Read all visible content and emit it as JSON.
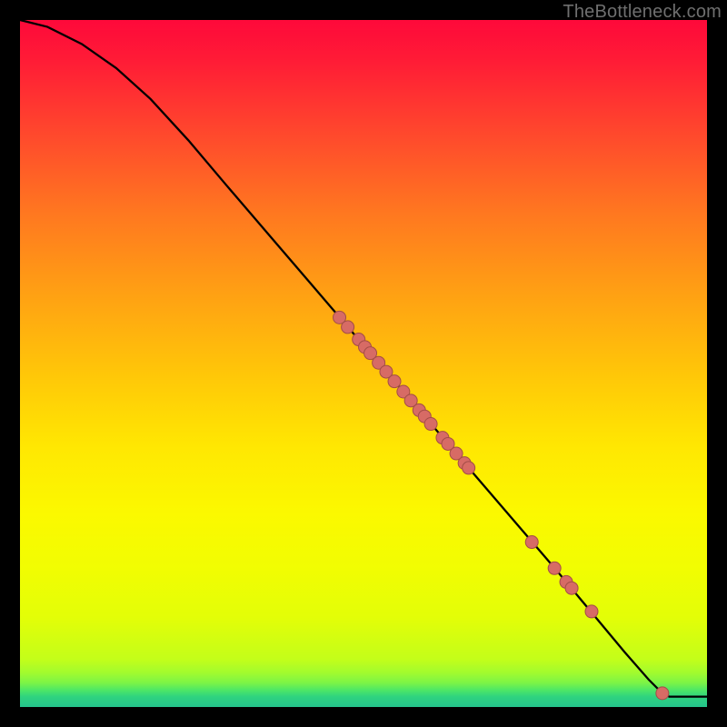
{
  "watermark": "TheBottleneck.com",
  "chart_data": {
    "type": "line",
    "title": "",
    "xlabel": "",
    "ylabel": "",
    "xlim": [
      0,
      100
    ],
    "ylim": [
      0,
      100
    ],
    "grid": false,
    "legend": false,
    "curve": [
      {
        "x": 0.0,
        "y": 100.0
      },
      {
        "x": 4.0,
        "y": 99.0
      },
      {
        "x": 9.0,
        "y": 96.5
      },
      {
        "x": 14.0,
        "y": 93.0
      },
      {
        "x": 19.0,
        "y": 88.5
      },
      {
        "x": 24.5,
        "y": 82.5
      },
      {
        "x": 30.0,
        "y": 76.0
      },
      {
        "x": 36.0,
        "y": 69.0
      },
      {
        "x": 42.0,
        "y": 62.0
      },
      {
        "x": 48.0,
        "y": 55.0
      },
      {
        "x": 54.0,
        "y": 48.0
      },
      {
        "x": 60.0,
        "y": 41.0
      },
      {
        "x": 66.0,
        "y": 34.0
      },
      {
        "x": 72.0,
        "y": 27.0
      },
      {
        "x": 78.0,
        "y": 20.0
      },
      {
        "x": 83.0,
        "y": 14.0
      },
      {
        "x": 88.0,
        "y": 8.0
      },
      {
        "x": 91.5,
        "y": 4.0
      },
      {
        "x": 93.5,
        "y": 2.0
      },
      {
        "x": 94.5,
        "y": 1.5
      },
      {
        "x": 100.0,
        "y": 1.5
      }
    ],
    "points": [
      {
        "x": 46.5,
        "y": 56.7
      },
      {
        "x": 47.7,
        "y": 55.3
      },
      {
        "x": 49.3,
        "y": 53.5
      },
      {
        "x": 50.2,
        "y": 52.4
      },
      {
        "x": 51.0,
        "y": 51.5
      },
      {
        "x": 52.2,
        "y": 50.1
      },
      {
        "x": 53.3,
        "y": 48.8
      },
      {
        "x": 54.5,
        "y": 47.4
      },
      {
        "x": 55.8,
        "y": 45.9
      },
      {
        "x": 56.9,
        "y": 44.6
      },
      {
        "x": 58.1,
        "y": 43.2
      },
      {
        "x": 58.9,
        "y": 42.3
      },
      {
        "x": 59.8,
        "y": 41.2
      },
      {
        "x": 61.5,
        "y": 39.2
      },
      {
        "x": 62.3,
        "y": 38.3
      },
      {
        "x": 63.5,
        "y": 36.9
      },
      {
        "x": 64.7,
        "y": 35.5
      },
      {
        "x": 65.3,
        "y": 34.8
      },
      {
        "x": 74.5,
        "y": 24.0
      },
      {
        "x": 77.8,
        "y": 20.2
      },
      {
        "x": 79.5,
        "y": 18.2
      },
      {
        "x": 80.3,
        "y": 17.3
      },
      {
        "x": 83.2,
        "y": 13.9
      },
      {
        "x": 93.5,
        "y": 2.0
      }
    ],
    "point_style": {
      "fill": "#d76b65",
      "stroke": "#a34d47",
      "radius": 7
    },
    "line_style": {
      "stroke": "#000000",
      "width": 2.3
    }
  }
}
